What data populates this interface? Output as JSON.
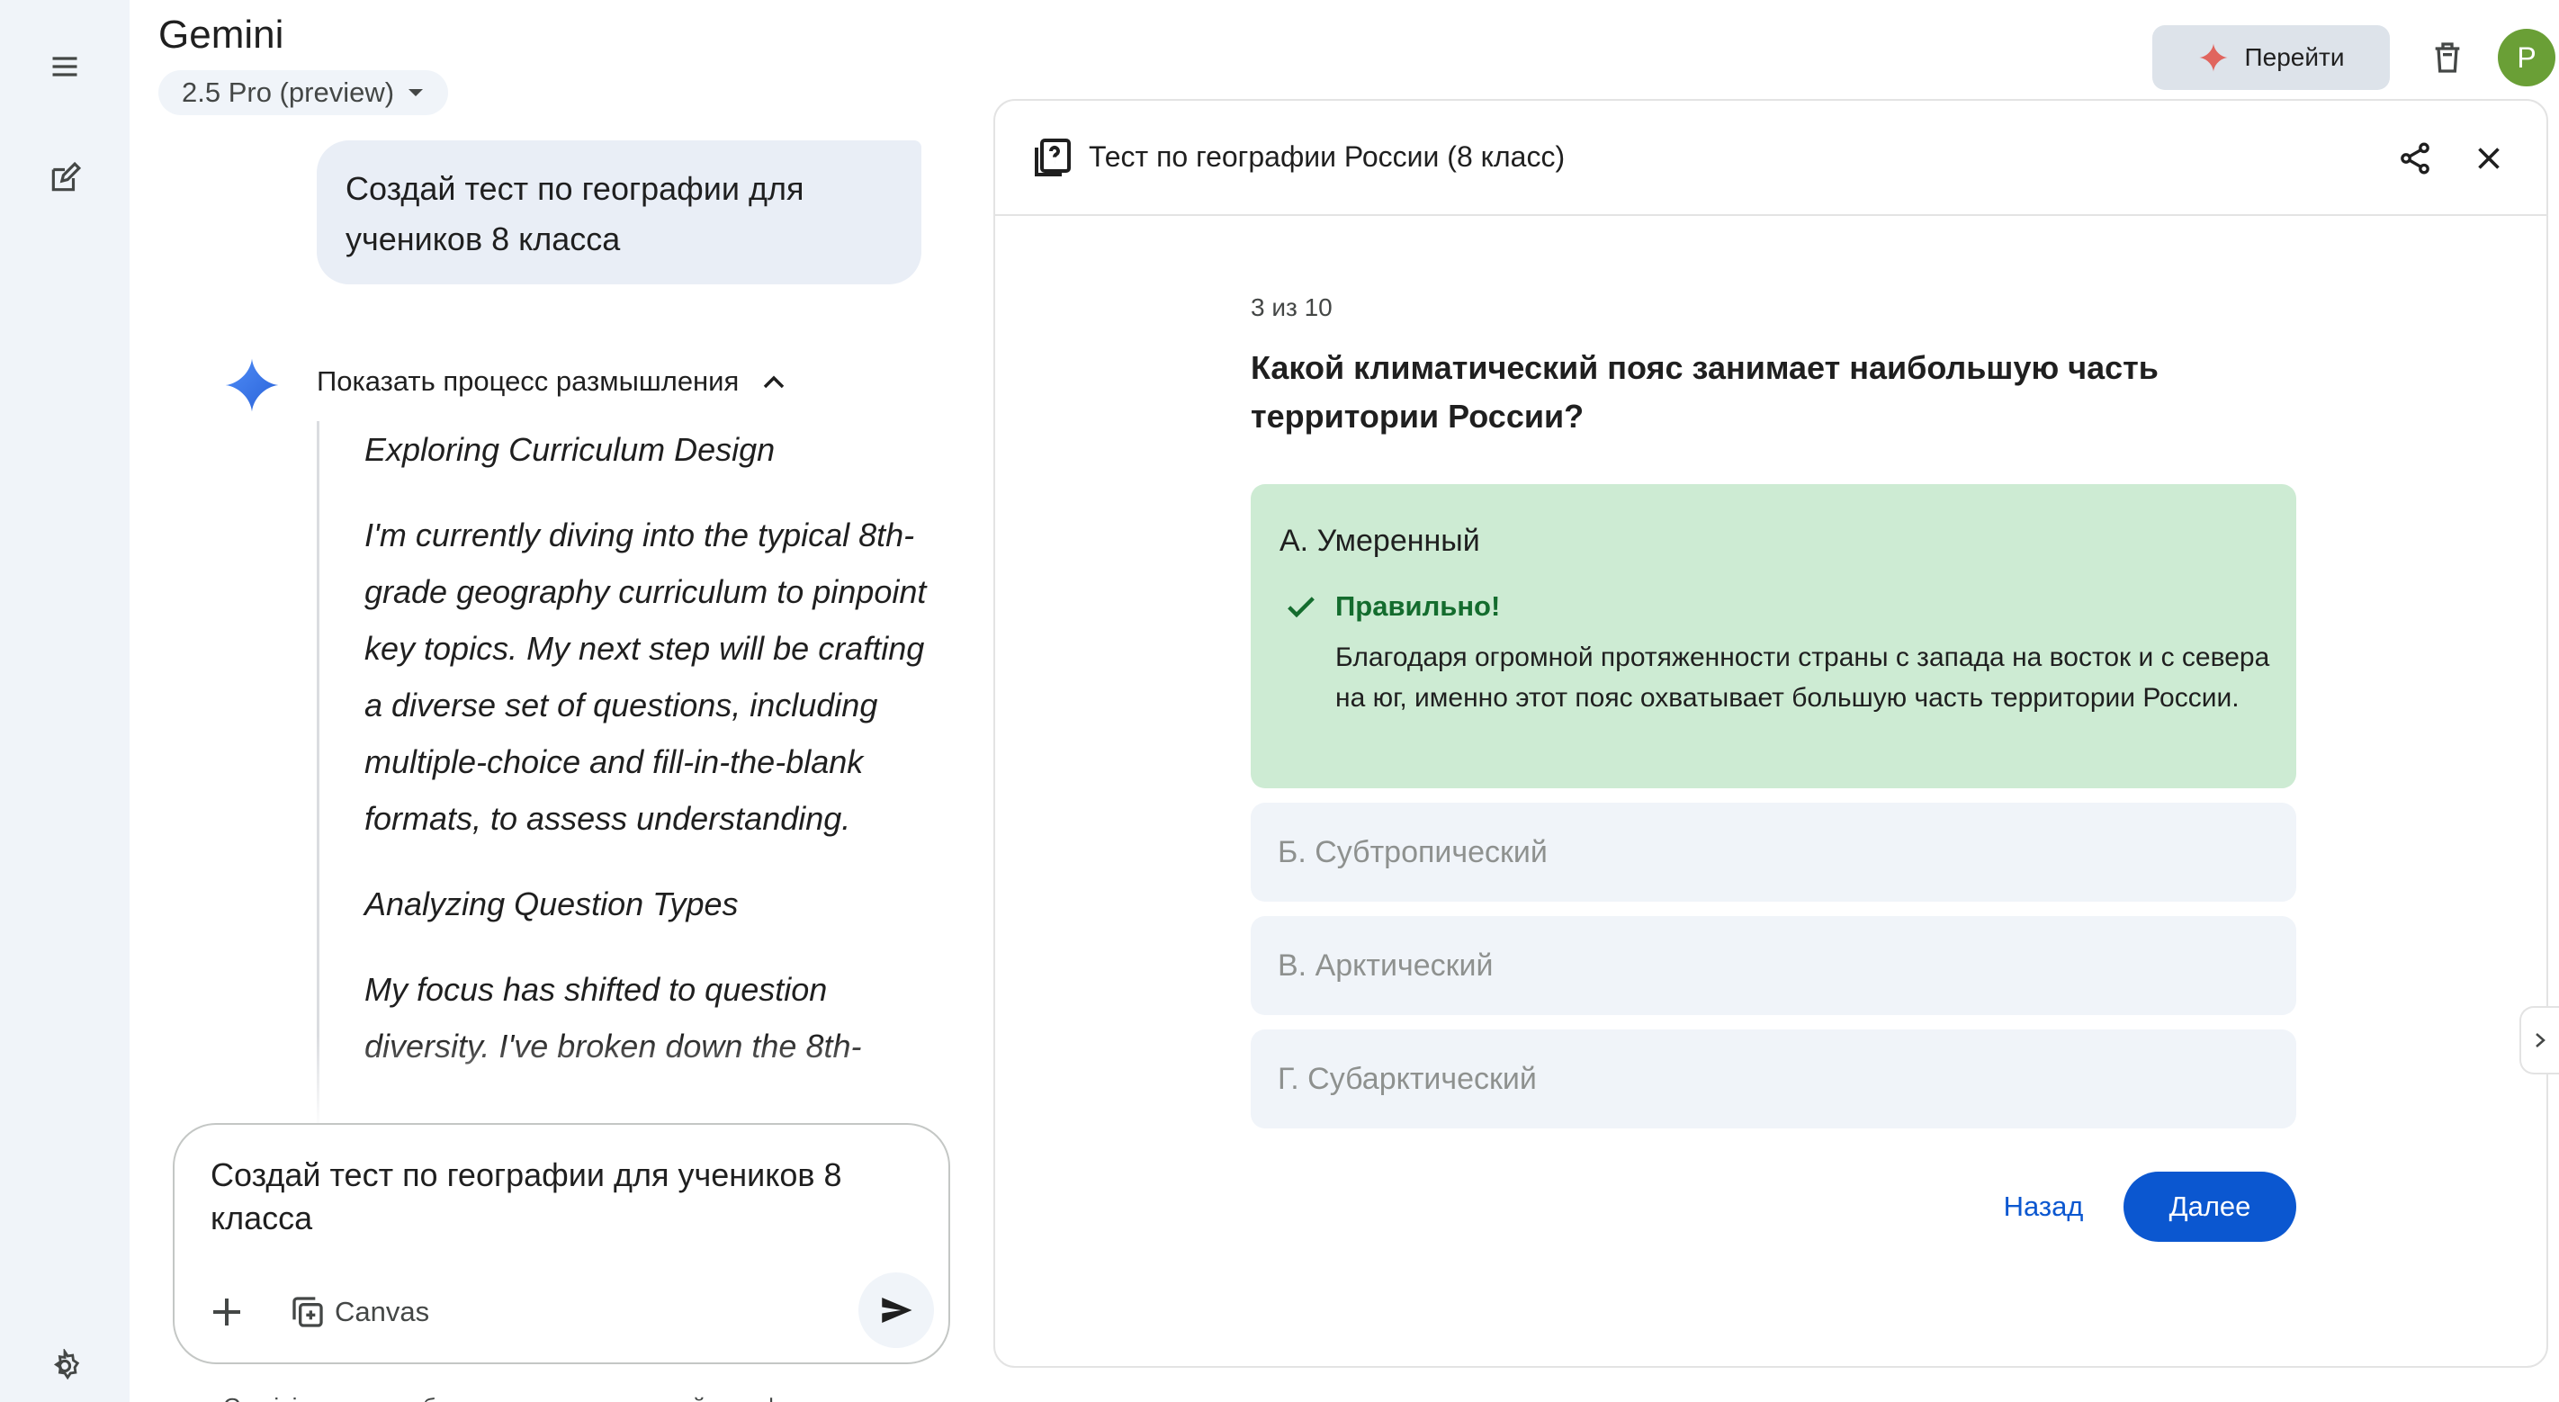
{
  "app": {
    "title": "Gemini",
    "model": "2.5 Pro (preview)"
  },
  "header": {
    "go_label": "Перейти",
    "avatar_letter": "P"
  },
  "chat": {
    "user_prompt": "Создай тест по географии для учеников 8 класса",
    "thinking_toggle": "Показать процесс размышления",
    "thinking": [
      "Exploring Curriculum Design",
      "I'm currently diving into the typical 8th-grade geography curriculum to pinpoint key topics. My next step will be crafting a diverse set of questions, including multiple-choice and fill-in-the-blank formats, to assess understanding.",
      "Analyzing Question Types",
      "My focus has shifted to question diversity. I've broken down the 8th-"
    ]
  },
  "composer": {
    "text": "Создай тест по географии для учеников 8 класса",
    "canvas_label": "Canvas"
  },
  "footer_text": "Gemini может ошибаться, поэтому проверяйте информацию",
  "panel": {
    "title": "Тест по географии России (8 класс)",
    "progress": "3 из 10",
    "question": "Какой климатический пояс занимает наибольшую часть территории России?",
    "correct_option": "А.  Умеренный",
    "feedback_title": "Правильно!",
    "feedback_text": "Благодаря огромной протяженности страны с запада на восток и с севера на юг, именно этот пояс охватывает большую часть территории России.",
    "options": [
      "Б.  Субтропический",
      "В.  Арктический",
      "Г.  Субарктический"
    ],
    "back_label": "Назад",
    "next_label": "Далее"
  },
  "colors": {
    "accent": "#0b57d0",
    "correct_bg": "#cdebd3",
    "correct_text": "#146c2e",
    "rail_bg": "#f0f4f9",
    "avatar_bg": "#6a9f36"
  }
}
